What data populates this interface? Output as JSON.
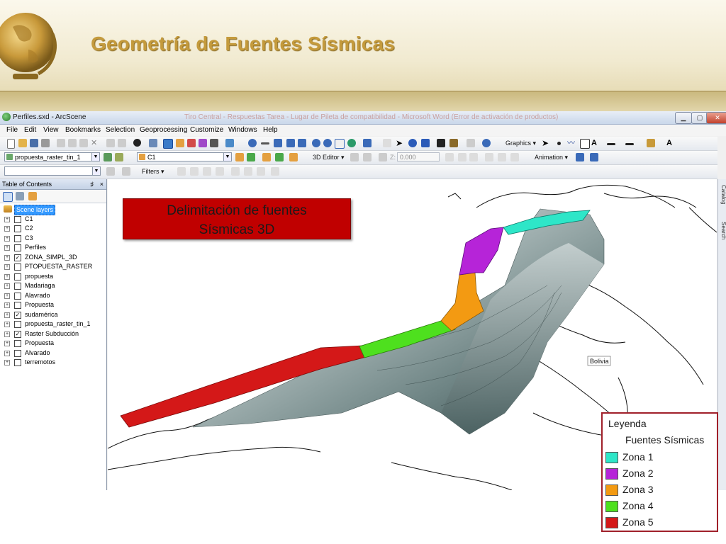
{
  "slide": {
    "title": "Geometría de Fuentes Sísmicas"
  },
  "window": {
    "title": "Perfiles.sxd - ArcScene",
    "faded_title": "Tiro Central - Respuestas Tarea - Lugar de Pileta de compatibilidad - Microsoft Word (Error de activación de productos)",
    "buttons": [
      "minimize",
      "maximize",
      "close"
    ]
  },
  "menu": {
    "items": [
      "File",
      "Edit",
      "View",
      "Bookmarks",
      "Selection",
      "Geoprocessing",
      "Customize",
      "Windows",
      "Help"
    ]
  },
  "toolbars": {
    "graphics_label": "Graphics ▾",
    "layer_combo": "propuesta_raster_tin_1",
    "scene_combo": "C1",
    "editor_label": "3D Editor ▾",
    "z_label": "Z:",
    "z_value": "0.000",
    "animation_label": "Animation ▾",
    "filters_label": "Filters ▾"
  },
  "toc": {
    "title": "Table of Contents",
    "pin": "♯",
    "close": "×",
    "root": "Scene layers",
    "layers": [
      {
        "name": "C1",
        "checked": false
      },
      {
        "name": "C2",
        "checked": false
      },
      {
        "name": "C3",
        "checked": false
      },
      {
        "name": "Perfiles",
        "checked": false
      },
      {
        "name": "ZONA_SIMPL_3D",
        "checked": true
      },
      {
        "name": "PTOPUESTA_RASTER",
        "checked": false
      },
      {
        "name": "propuesta",
        "checked": false
      },
      {
        "name": "Madariaga",
        "checked": false
      },
      {
        "name": "Alavrado",
        "checked": false
      },
      {
        "name": "Propuesta",
        "checked": false
      },
      {
        "name": "sudamérica",
        "checked": true
      },
      {
        "name": "propuesta_raster_tin_1",
        "checked": false
      },
      {
        "name": "Raster Subducción",
        "checked": true
      },
      {
        "name": "Propuesta",
        "checked": false
      },
      {
        "name": "Alvarado",
        "checked": false
      },
      {
        "name": "terremotos",
        "checked": false
      }
    ]
  },
  "side_tabs": [
    "Catalog",
    "Search"
  ],
  "map": {
    "country_label": "Bolivia"
  },
  "banner": {
    "line1": "Delimitación de fuentes",
    "line2": "Sísmicas 3D"
  },
  "legend": {
    "title": "Leyenda",
    "subtitle": "Fuentes Sísmicas",
    "items": [
      {
        "label": "Zona 1",
        "color": "#2ee6c8"
      },
      {
        "label": "Zona 2",
        "color": "#b624d8"
      },
      {
        "label": "Zona 3",
        "color": "#f39a12"
      },
      {
        "label": "Zona 4",
        "color": "#4ee01e"
      },
      {
        "label": "Zona 5",
        "color": "#d41818"
      }
    ]
  },
  "colors": {
    "title_gold": "#c49a3c",
    "banner_red": "#c00000",
    "legend_border": "#a0202a"
  }
}
